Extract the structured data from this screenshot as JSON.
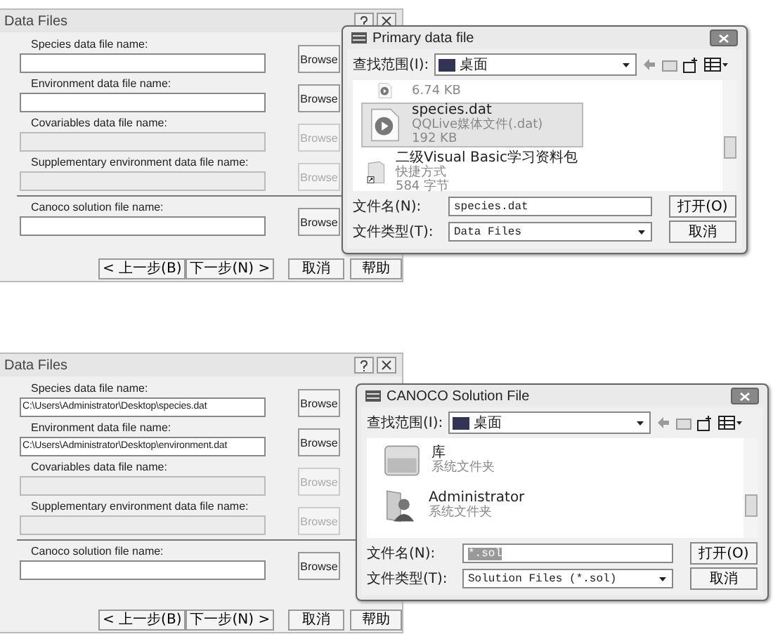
{
  "panels": [
    {
      "wizard": {
        "title": "Data Files",
        "fields": [
          {
            "label": "Species data file name:",
            "enabled": true,
            "button": "Browse"
          },
          {
            "label": "Environment data file name:",
            "enabled": true,
            "button": "Browse"
          },
          {
            "label": "Covariables data file name:",
            "enabled": false,
            "button": "Browse"
          },
          {
            "label": "Supplementary environment data file name:",
            "enabled": false,
            "button": "Browse"
          },
          {
            "label": "Canoco solution file name:",
            "enabled": true,
            "button": "Browse"
          }
        ],
        "buttons": [
          "< 上一步(B)",
          "下一步(N) >",
          "取消",
          "帮助"
        ]
      },
      "file_dialog": {
        "title": "Primary data file",
        "look_in_label": "查找范围(I):",
        "look_in": "桌面",
        "files": [
          {
            "kind": "media",
            "size": "6.74 KB",
            "selected": false
          },
          {
            "kind": "media",
            "name": "species.dat",
            "type": "QQLive媒体文件(.dat)",
            "size": "192 KB",
            "selected": true
          },
          {
            "kind": "shortcut",
            "name": "二级Visual Basic学习资料包",
            "type": "快捷方式",
            "size": "584 字节",
            "selected": false
          }
        ],
        "filename_label": "文件名(N):",
        "filename": "species.dat",
        "filename_highlighted": false,
        "filetype_label": "文件类型(T):",
        "filetype": "Data Files",
        "open_button": "打开(O)",
        "cancel_button": "取消"
      }
    },
    {
      "wizard": {
        "title": "Data Files",
        "fields": [
          {
            "label": "Species data file name:",
            "value": "C:\\Users\\Administrator\\Desktop\\species.dat",
            "enabled": true,
            "button": "Browse"
          },
          {
            "label": "Environment data file name:",
            "value": "C:\\Users\\Administrator\\Desktop\\environment.dat",
            "enabled": true,
            "button": "Browse"
          },
          {
            "label": "Covariables data file name:",
            "enabled": false,
            "button": "Browse"
          },
          {
            "label": "Supplementary environment data file name:",
            "enabled": false,
            "button": "Browse"
          },
          {
            "label": "Canoco solution file name:",
            "enabled": true,
            "button": "Browse"
          }
        ],
        "buttons": [
          "< 上一步(B)",
          "下一步(N) >",
          "取消",
          "帮助"
        ]
      },
      "file_dialog": {
        "title": "CANOCO Solution File",
        "look_in_label": "查找范围(I):",
        "look_in": "桌面",
        "files": [
          {
            "kind": "library",
            "name": "库",
            "type": "系统文件夹",
            "selected": false
          },
          {
            "kind": "user",
            "name": "Administrator",
            "type": "系统文件夹",
            "selected": false
          }
        ],
        "filename_label": "文件名(N):",
        "filename": "*.sol",
        "filename_highlighted": true,
        "filetype_label": "文件类型(T):",
        "filetype": "Solution Files (*.sol)",
        "open_button": "打开(O)",
        "cancel_button": "取消"
      }
    }
  ]
}
